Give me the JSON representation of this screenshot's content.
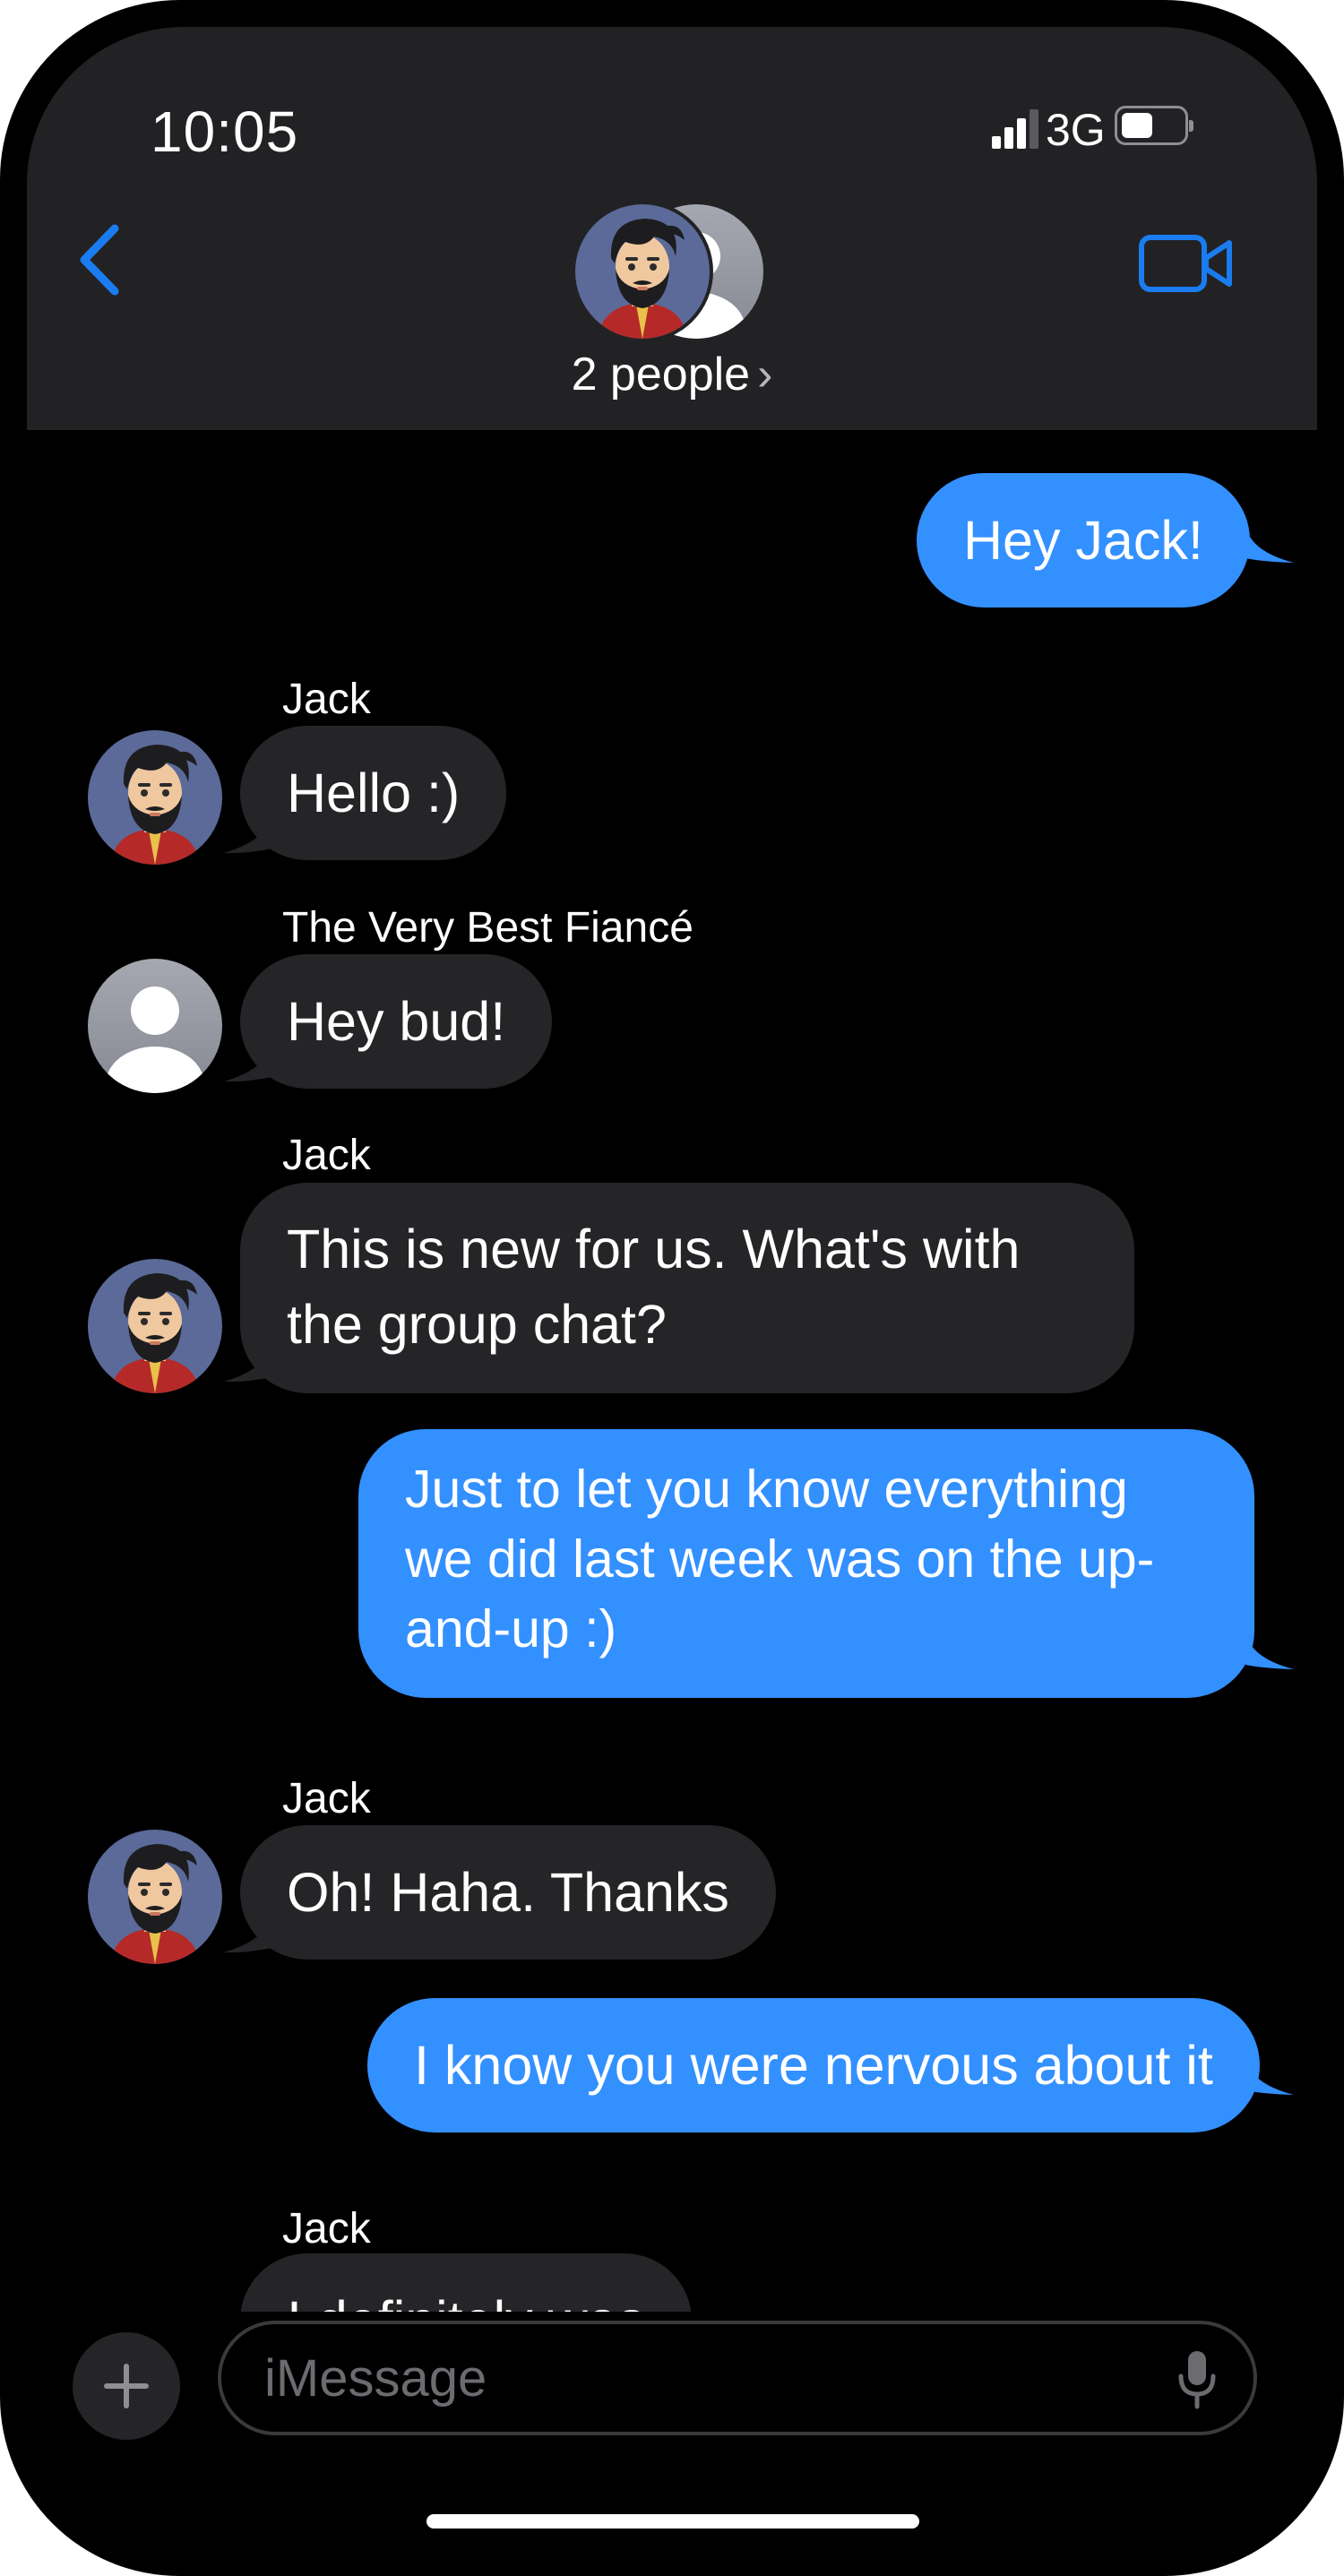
{
  "status_bar": {
    "time": "10:05",
    "network": "3G"
  },
  "header": {
    "people_label": "2 people",
    "people_chevron": "›"
  },
  "messages": [
    {
      "type": "sent",
      "text": "Hey Jack!"
    },
    {
      "type": "received",
      "sender": "Jack",
      "text": "Hello :)"
    },
    {
      "type": "received",
      "sender": "The Very Best Fiancé",
      "text": "Hey bud!"
    },
    {
      "type": "received",
      "sender": "Jack",
      "text": "This is new for us.  What's with the group chat?"
    },
    {
      "type": "sent",
      "text": "Just to let you know everything we did last week was on the up-and-up :)"
    },
    {
      "type": "received",
      "sender": "Jack",
      "text": "Oh!  Haha.  Thanks"
    },
    {
      "type": "sent",
      "text": "I know you were nervous about it"
    },
    {
      "type": "received",
      "sender": "Jack",
      "text": "I definitely was"
    }
  ],
  "composer": {
    "placeholder": "iMessage",
    "attach_symbol": "+"
  },
  "colors": {
    "sent_bubble": "#3390ff",
    "received_bubble": "#252528",
    "header_bg": "#222224",
    "accent_blue": "#1a7cf0"
  }
}
